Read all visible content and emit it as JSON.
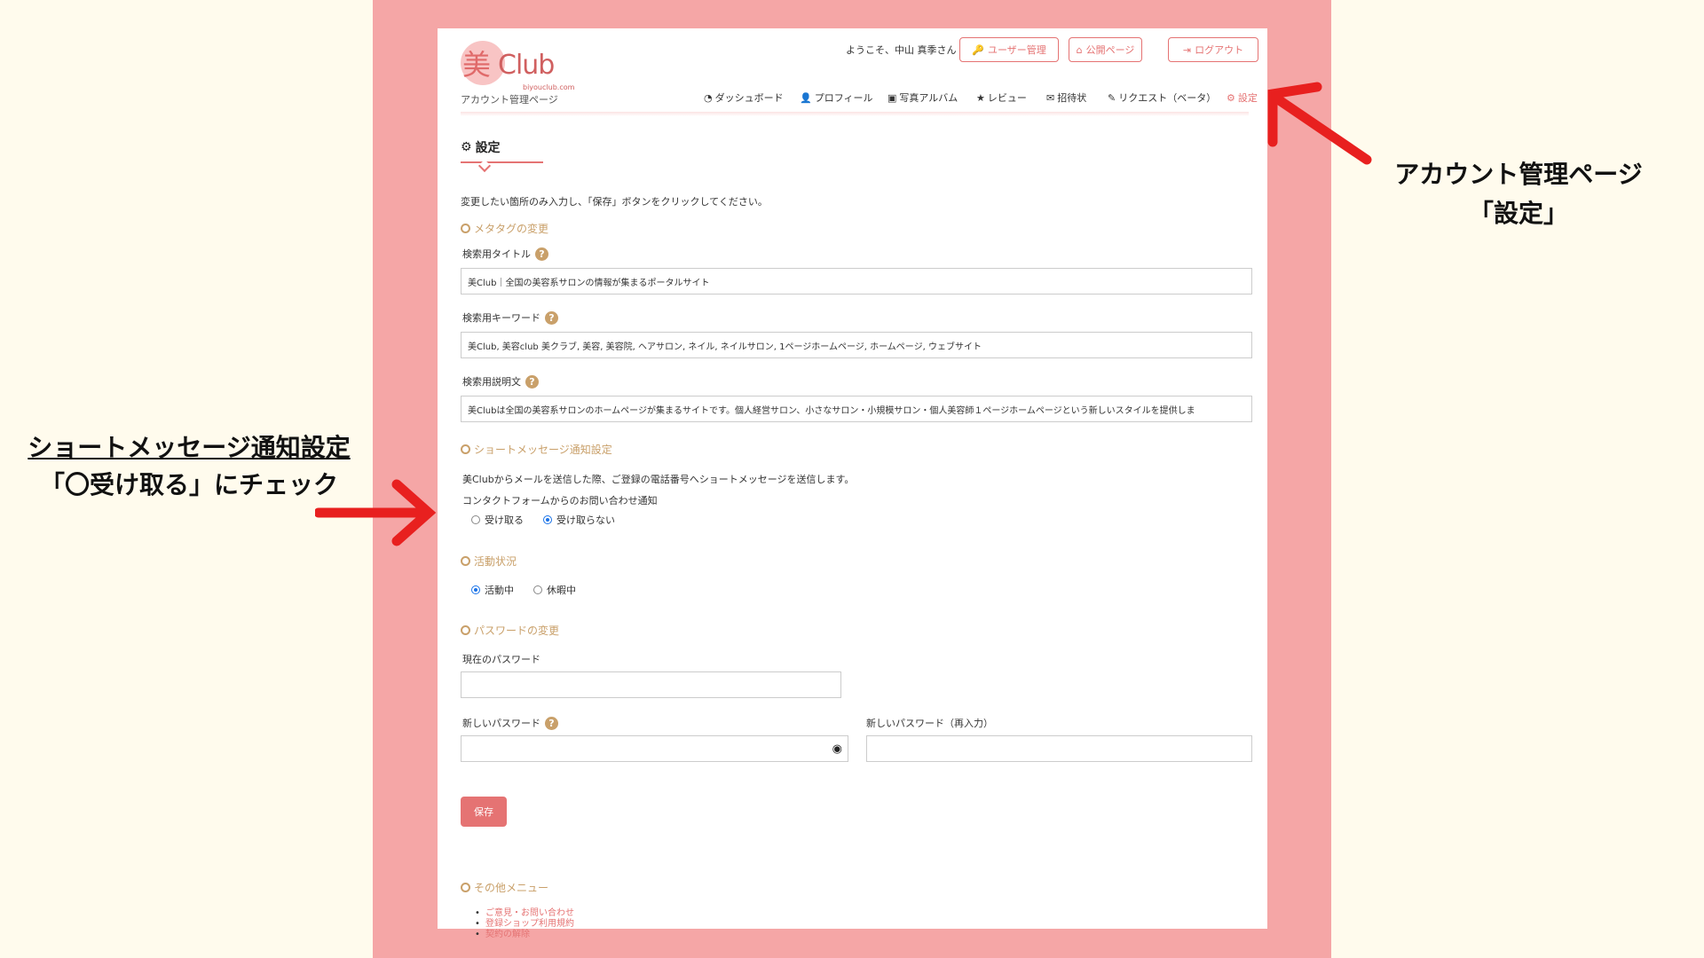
{
  "header": {
    "logo_kanji": "美",
    "logo_word": "Club",
    "logo_domain": "biyouclub.com",
    "account_label": "アカウント管理ページ",
    "welcome": "ようこそ、中山 真季さん",
    "buttons": {
      "user_manage": "ユーザー管理",
      "public_page": "公開ページ",
      "logout": "ログアウト"
    }
  },
  "nav": {
    "dashboard": "ダッシュボード",
    "profile": "プロフィール",
    "album": "写真アルバム",
    "review": "レビュー",
    "invitation": "招待状",
    "request": "リクエスト（ベータ）",
    "settings": "設定"
  },
  "main": {
    "title": "設定",
    "intro": "変更したい箇所のみ入力し、「保存」ボタンをクリックしてください。",
    "meta": {
      "heading": "メタタグの変更",
      "search_title_label": "検索用タイトル",
      "search_title_value": "美Club｜全国の美容系サロンの情報が集まるポータルサイト",
      "keywords_label": "検索用キーワード",
      "keywords_value": "美Club, 美容club 美クラブ, 美容, 美容院, ヘアサロン, ネイル, ネイルサロン, 1ページホームページ, ホームページ, ウェブサイト",
      "description_label": "検索用説明文",
      "description_value": "美Clubは全国の美容系サロンのホームページが集まるサイトです。個人経営サロン、小さなサロン・小規模サロン・個人美容師１ページホームページという新しいスタイルを提供しま"
    },
    "sms": {
      "heading": "ショートメッセージ通知設定",
      "note": "美Clubからメールを送信した際、ご登録の電話番号へショートメッセージを送信します。",
      "contact_label": "コンタクトフォームからのお問い合わせ通知",
      "receive": "受け取る",
      "not_receive": "受け取らない"
    },
    "status": {
      "heading": "活動状況",
      "active": "活動中",
      "rest": "休暇中"
    },
    "password": {
      "heading": "パスワードの変更",
      "current_label": "現在のパスワード",
      "new_label": "新しいパスワード",
      "new_confirm_label": "新しいパスワード（再入力）"
    },
    "save_label": "保存",
    "other": {
      "heading": "その他メニュー",
      "items": [
        "ご意見・お問い合わせ",
        "登録ショップ利用規約",
        "契約の解除"
      ]
    }
  },
  "annotations": {
    "right_line1": "アカウント管理ページ",
    "right_line2": "「設定」",
    "left_line1": "ショートメッセージ通知設定",
    "left_line2": "「〇受け取る」にチェック"
  },
  "colors": {
    "accent": "#e57373",
    "frame": "#f5a6a6",
    "background": "#fffbed",
    "gold": "#c9a06a",
    "arrow": "#e8201f"
  }
}
